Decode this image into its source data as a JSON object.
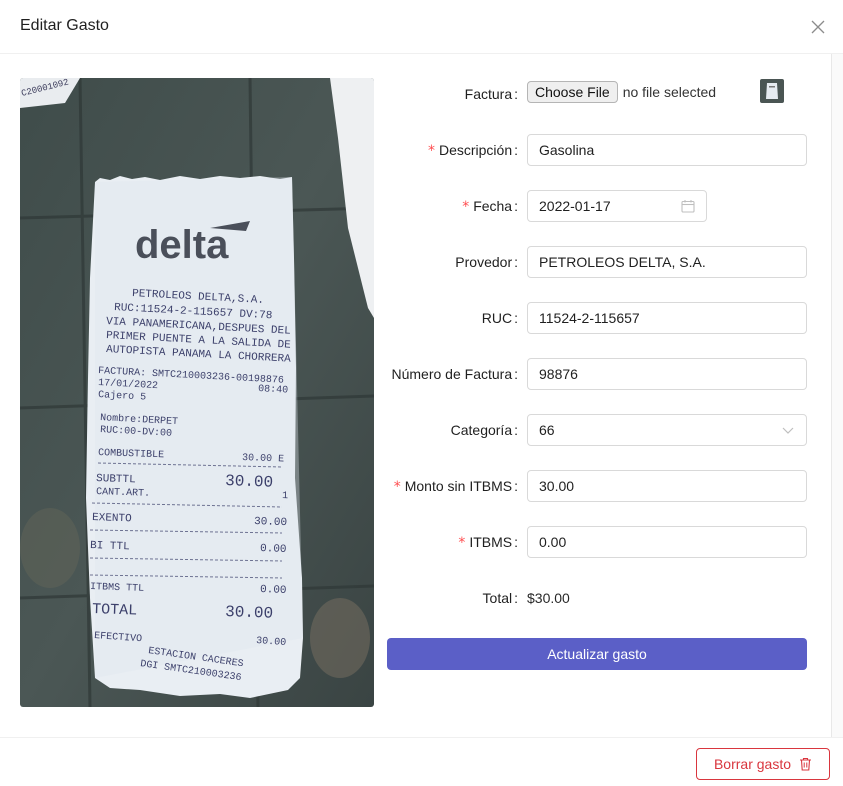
{
  "modal": {
    "title": "Editar Gasto"
  },
  "receipt": {
    "logo": "delta",
    "lines": [
      "PETROLEOS DELTA,S.A.",
      "RUC:11524-2-115657  DV:78",
      "VIA PANAMERICANA,DESPUES DEL",
      "PRIMER PUENTE A LA SALIDA DE",
      "AUTOPISTA PANAMA LA CHORRERA",
      "FACTURA:  SMTC210003236-00198876",
      "17/01/2022",
      "08:40",
      "Cajero 5",
      "Nombre:DERPET",
      "RUC:00-DV:00",
      "COMBUSTIBLE",
      "30.00 E",
      "SUBTTL",
      "30.00",
      "CANT.ART.",
      "1",
      "EXENTO",
      "30.00",
      "BI TTL",
      "0.00",
      "ITBMS TTL",
      "0.00",
      "TOTAL",
      "30.00",
      "EFECTIVO",
      "30.00",
      "ESTACION CACERES",
      "DGI  SMTC210003236",
      "C20001092"
    ]
  },
  "form": {
    "factura": {
      "label": "Factura",
      "button": "Choose File",
      "status": "no file selected"
    },
    "descripcion": {
      "label": "Descripción",
      "value": "Gasolina"
    },
    "fecha": {
      "label": "Fecha",
      "value": "2022-01-17"
    },
    "provedor": {
      "label": "Provedor",
      "value": "PETROLEOS DELTA, S.A."
    },
    "ruc": {
      "label": "RUC",
      "value": "11524-2-115657"
    },
    "numero_factura": {
      "label": "Número de Factura",
      "value": "98876"
    },
    "categoria": {
      "label": "Categoría",
      "value": "66"
    },
    "monto": {
      "label": "Monto sin ITBMS",
      "value": "30.00"
    },
    "itbms": {
      "label": "ITBMS",
      "value": "0.00"
    },
    "total": {
      "label": "Total",
      "value": "$30.00"
    },
    "submit_label": "Actualizar gasto",
    "required_mark": "*",
    "colon": ":"
  },
  "footer": {
    "delete_label": "Borrar gasto"
  },
  "colors": {
    "primary": "#5b5fc7",
    "danger": "#d9363e",
    "required": "#ff4d4f",
    "border": "#d9d9d9"
  },
  "icons": [
    "close-icon",
    "calendar-icon",
    "chevron-down-icon",
    "trash-icon"
  ]
}
